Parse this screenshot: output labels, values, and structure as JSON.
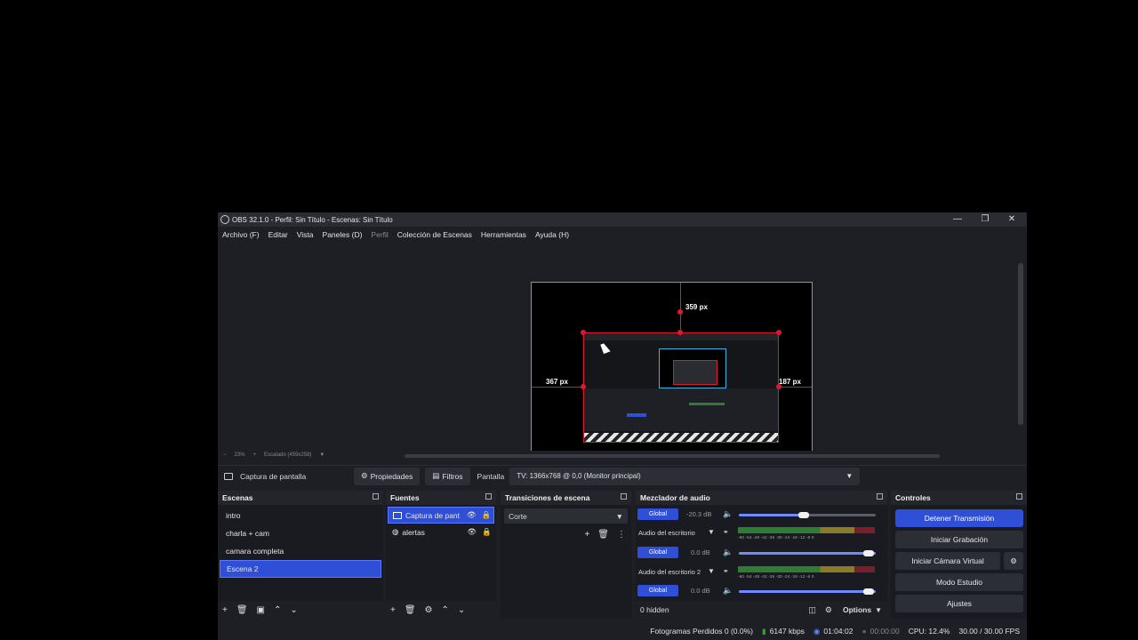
{
  "window": {
    "title": "OBS 32.1.0 - Perfil: Sin Título - Escenas: Sin Título",
    "controls": {
      "minimize": "—",
      "maximize": "❐",
      "close": "✕"
    }
  },
  "menu": [
    "Archivo (F)",
    "Editar",
    "Vista",
    "Paneles (D)",
    "Perfil",
    "Colección de Escenas",
    "Herramientas",
    "Ayuda (H)"
  ],
  "preview": {
    "top_measure": "359 px",
    "left_measure": "367 px",
    "right_measure": "187 px",
    "zoom": "23%",
    "scale_label": "Escalado (459x258)"
  },
  "source_bar": {
    "selected_source": "Captura de pantalla",
    "properties_label": "Propiedades",
    "filters_label": "Filtros",
    "screen_label": "Pantalla",
    "screen_value": "TV: 1366x768 @ 0,0 (Monitor principal)"
  },
  "scenes": {
    "title": "Escenas",
    "items": [
      "intro",
      "charla + cam",
      "camara completa",
      "Escena 2"
    ],
    "selected": "Escena 2"
  },
  "sources": {
    "title": "Fuentes",
    "items": [
      "Captura de pant",
      "alertas"
    ]
  },
  "transitions": {
    "title": "Transiciones de escena",
    "current": "Corte"
  },
  "mixer": {
    "title": "Mezclador de audio",
    "rows": [
      {
        "tag": "Global",
        "db": "-20.3 dB",
        "level": 0.47
      },
      {
        "name": "Audio del escritorio",
        "ticks": "-60 -54 -48 -42 -36 -30 -24 -18 -12 -6 0"
      },
      {
        "tag": "Global",
        "db": "0.0 dB",
        "level": 1.0
      },
      {
        "name": "Audio del escritorio 2",
        "ticks": "-60 -54 -48 -42 -36 -30 -24 -18 -12 -6 0"
      },
      {
        "tag": "Global",
        "db": "0.0 dB",
        "level": 1.0
      }
    ],
    "hidden": "0 hidden",
    "options": "Options"
  },
  "controls": {
    "title": "Controles",
    "stop_stream": "Detener Transmisión",
    "start_record": "Iniciar Grabación",
    "virtual_cam": "Iniciar Cámara Virtual",
    "studio_mode": "Modo Estudio",
    "settings": "Ajustes"
  },
  "status": {
    "dropped": "Fotogramas Perdidos 0 (0.0%)",
    "bitrate": "6147 kbps",
    "stream_time": "01:04:02",
    "record_time": "00:00:00",
    "cpu": "CPU: 12.4%",
    "fps": "30.00 / 30.00 FPS"
  },
  "colors": {
    "accent": "#2f4fd6",
    "preview_border": "#3bb3e0",
    "selection": "#e0182b"
  }
}
